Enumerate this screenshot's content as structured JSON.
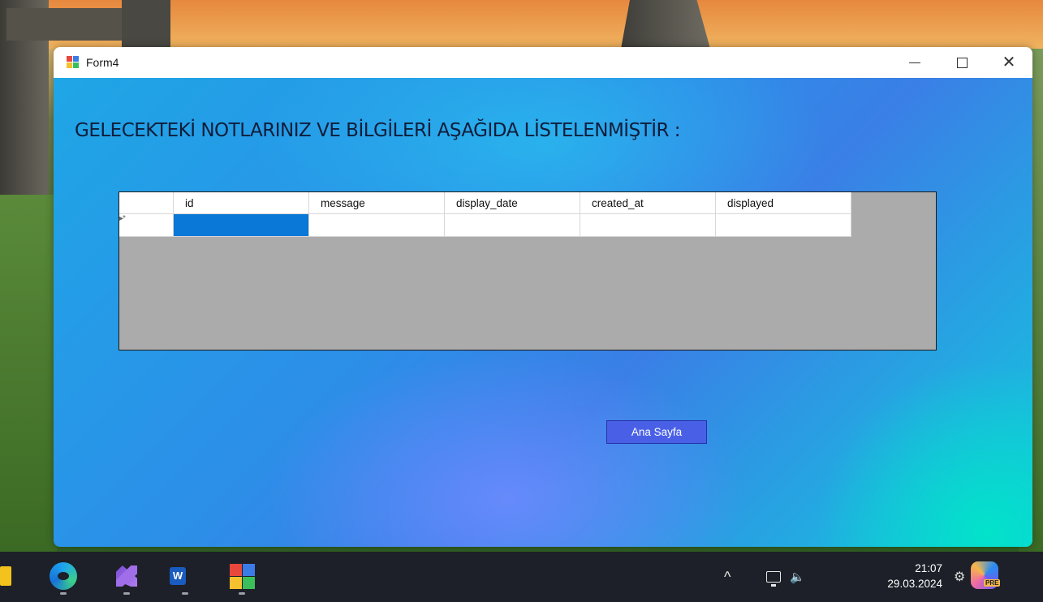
{
  "window": {
    "title": "Form4",
    "heading": "GELECEKTEKİ NOTLARINIZ VE BİLGİLERİ AŞAĞIDA LİSTELENMİŞTİR :"
  },
  "grid": {
    "columns": [
      "id",
      "message",
      "display_date",
      "created_at",
      "displayed"
    ],
    "new_row_marker": "▸*",
    "selected_column": "id"
  },
  "buttons": {
    "home_label": "Ana Sayfa"
  },
  "taskbar": {
    "time": "21:07",
    "date": "29.03.2024",
    "apps": [
      "file-explorer",
      "edge",
      "visual-studio",
      "word",
      "form-app"
    ],
    "copilot_badge": "PRE"
  },
  "colors": {
    "selected_cell": "#0a78d7",
    "button": "#4960e6",
    "grid_background": "#ababab"
  }
}
